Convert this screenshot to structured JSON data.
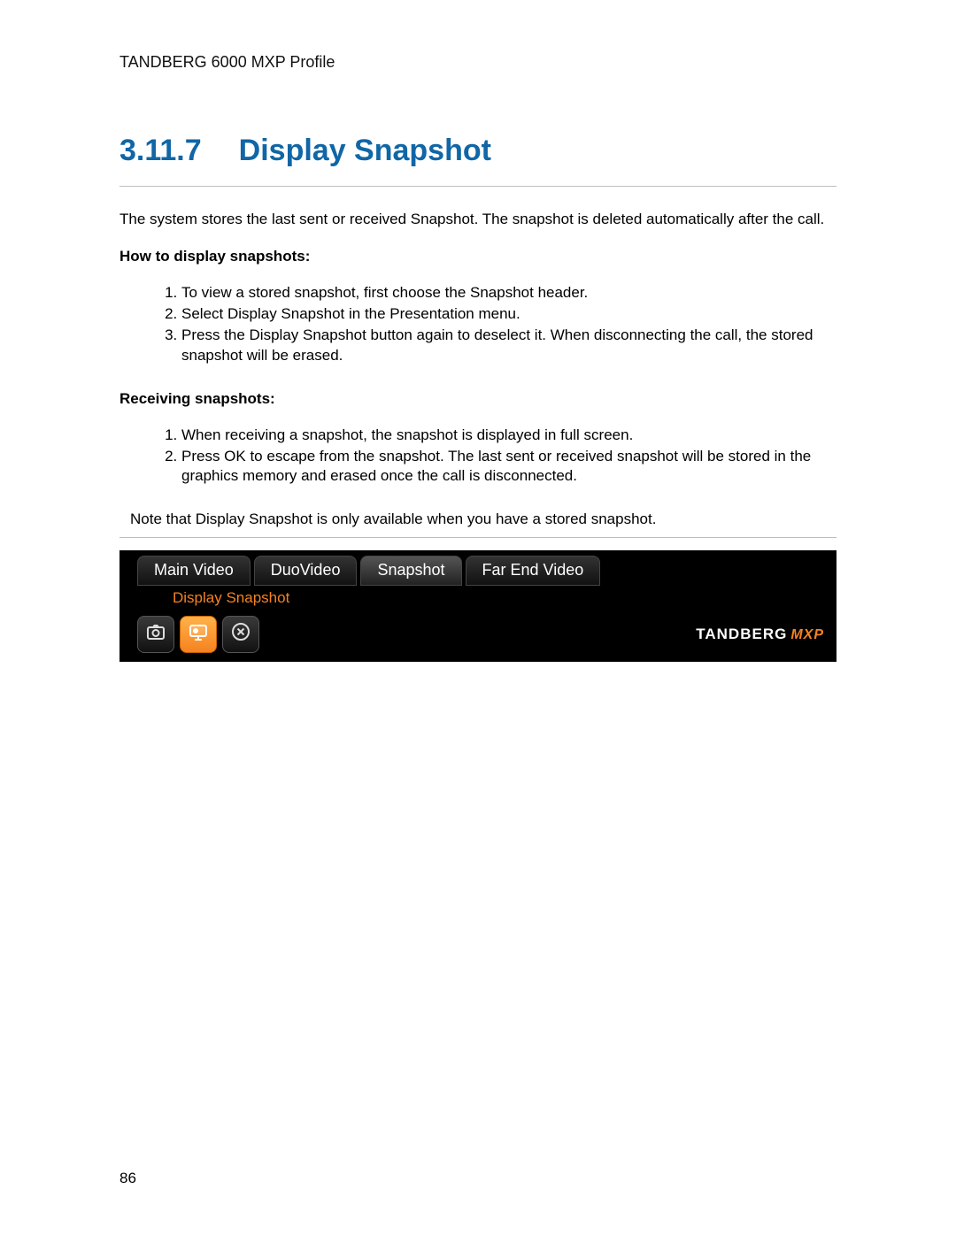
{
  "header": {
    "product": "TANDBERG 6000 MXP Profile"
  },
  "section": {
    "number": "3.11.7",
    "title": "Display Snapshot"
  },
  "intro": "The system stores the last sent or received Snapshot. The snapshot is deleted automatically after the call.",
  "howto": {
    "heading": "How to display snapshots:",
    "steps": [
      "To view a stored snapshot, first choose the Snapshot header.",
      "Select Display Snapshot in the Presentation menu.",
      "Press the Display Snapshot button again to deselect it. When disconnecting the call, the stored snapshot will be erased."
    ]
  },
  "receiving": {
    "heading": "Receiving snapshots:",
    "steps": [
      "When receiving a snapshot, the snapshot is displayed in full screen.",
      "Press OK to escape from the snapshot. The last sent or received snapshot will be stored in the graphics memory and erased once the call is disconnected."
    ]
  },
  "note": "Note that Display Snapshot is only available when you have a stored snapshot.",
  "ui": {
    "tabs": [
      "Main Video",
      "DuoVideo",
      "Snapshot",
      "Far End Video"
    ],
    "active_tab_index": 2,
    "submenu_label": "Display Snapshot",
    "brand": {
      "name": "TANDBERG",
      "suffix": "MXP"
    },
    "icons": [
      {
        "name": "camera-icon",
        "selected": false
      },
      {
        "name": "display-snapshot-icon",
        "selected": true
      },
      {
        "name": "close-icon",
        "selected": false
      }
    ]
  },
  "page_number": "86"
}
